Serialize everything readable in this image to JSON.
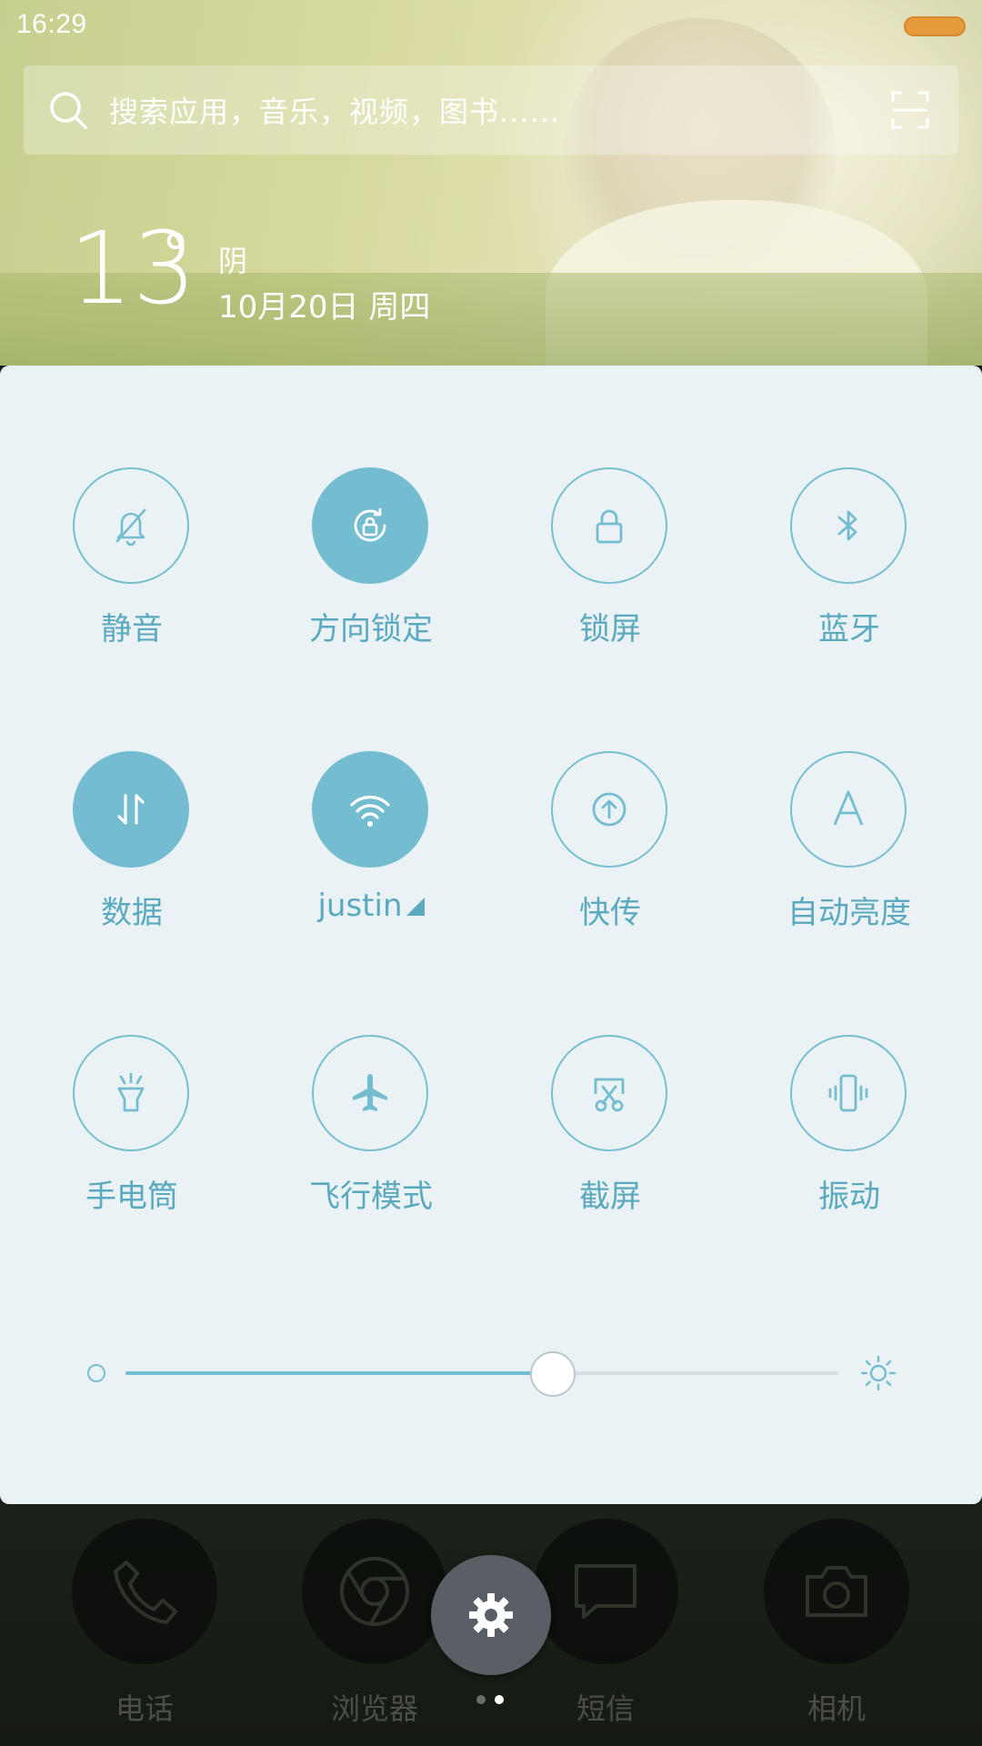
{
  "status_bar": {
    "time": "16:29",
    "battery_color": "#e79a3c"
  },
  "search": {
    "placeholder": "搜索应用，音乐，视频，图书......"
  },
  "weather": {
    "temperature": "13",
    "degree_symbol": "°",
    "condition": "阴",
    "date": "10月20日 周四"
  },
  "accent_color": "#74bdd0",
  "toggles": [
    {
      "label": "静音",
      "icon": "bell-off-icon",
      "active": false
    },
    {
      "label": "方向锁定",
      "icon": "rotation-lock-icon",
      "active": true
    },
    {
      "label": "锁屏",
      "icon": "lock-icon",
      "active": false
    },
    {
      "label": "蓝牙",
      "icon": "bluetooth-icon",
      "active": false
    },
    {
      "label": "数据",
      "icon": "mobile-data-icon",
      "active": true
    },
    {
      "label": "justin",
      "icon": "wifi-icon",
      "active": true
    },
    {
      "label": "快传",
      "icon": "share-upload-icon",
      "active": false
    },
    {
      "label": "自动亮度",
      "icon": "auto-brightness-icon",
      "active": false
    },
    {
      "label": "手电筒",
      "icon": "flashlight-icon",
      "active": false
    },
    {
      "label": "飞行模式",
      "icon": "airplane-icon",
      "active": false
    },
    {
      "label": "截屏",
      "icon": "screenshot-icon",
      "active": false
    },
    {
      "label": "振动",
      "icon": "vibrate-icon",
      "active": false
    }
  ],
  "brightness": {
    "level_percent": 60
  },
  "dock": {
    "apps": [
      {
        "label": "电话",
        "icon": "phone-icon"
      },
      {
        "label": "浏览器",
        "icon": "browser-icon"
      },
      {
        "label": "短信",
        "icon": "message-icon"
      },
      {
        "label": "相机",
        "icon": "camera-icon"
      }
    ]
  },
  "settings_button": {
    "icon": "gear-icon"
  },
  "pager": {
    "pages": 2,
    "current": 2
  }
}
